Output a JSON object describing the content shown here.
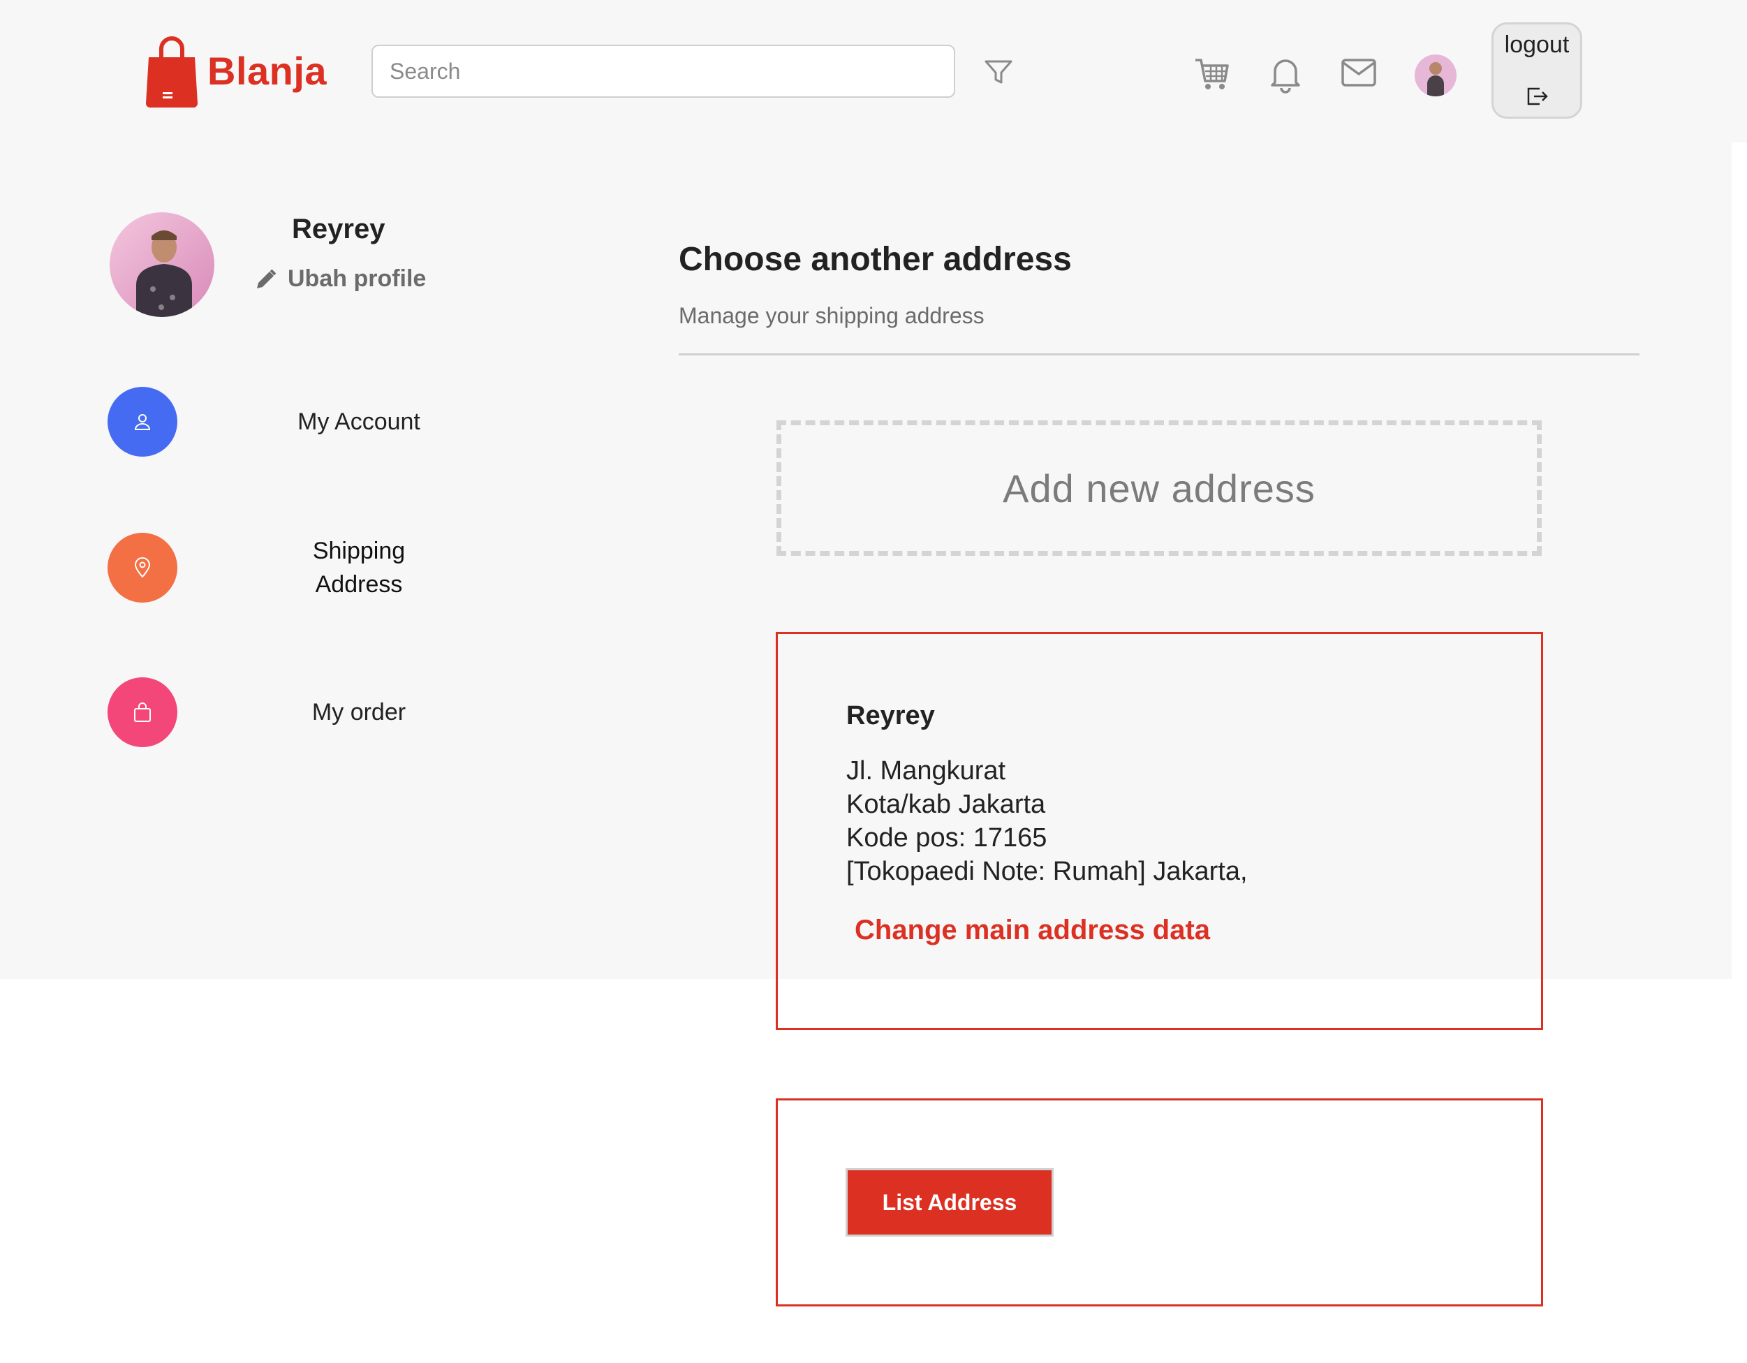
{
  "brand": {
    "name": "Blanja",
    "color": "#db3022"
  },
  "header": {
    "search_placeholder": "Search",
    "icons": [
      "filter-icon",
      "cart-icon",
      "bell-icon",
      "mail-icon",
      "avatar",
      "logout-icon"
    ],
    "logout_label": "logout"
  },
  "sidebar": {
    "user_name": "Reyrey",
    "edit_profile": "Ubah profile",
    "items": [
      {
        "label": "My Account",
        "icon": "user-icon",
        "color": "#456bf2"
      },
      {
        "label_line1": "Shipping",
        "label_line2": "Address",
        "icon": "location-pin-icon",
        "color": "#f36f44"
      },
      {
        "label": "My order",
        "icon": "shopping-bag-icon",
        "color": "#f3477a"
      }
    ]
  },
  "main": {
    "title": "Choose another address",
    "subtitle": "Manage your shipping address",
    "add_new": "Add new address",
    "address": {
      "name": "Reyrey",
      "line1": "Jl. Mangkurat",
      "line2": "Kota/kab Jakarta",
      "line3": "Kode pos: 17165",
      "line4": "[Tokopaedi Note: Rumah] Jakarta,",
      "change_link": "Change main address data"
    },
    "list_button": "List Address"
  }
}
